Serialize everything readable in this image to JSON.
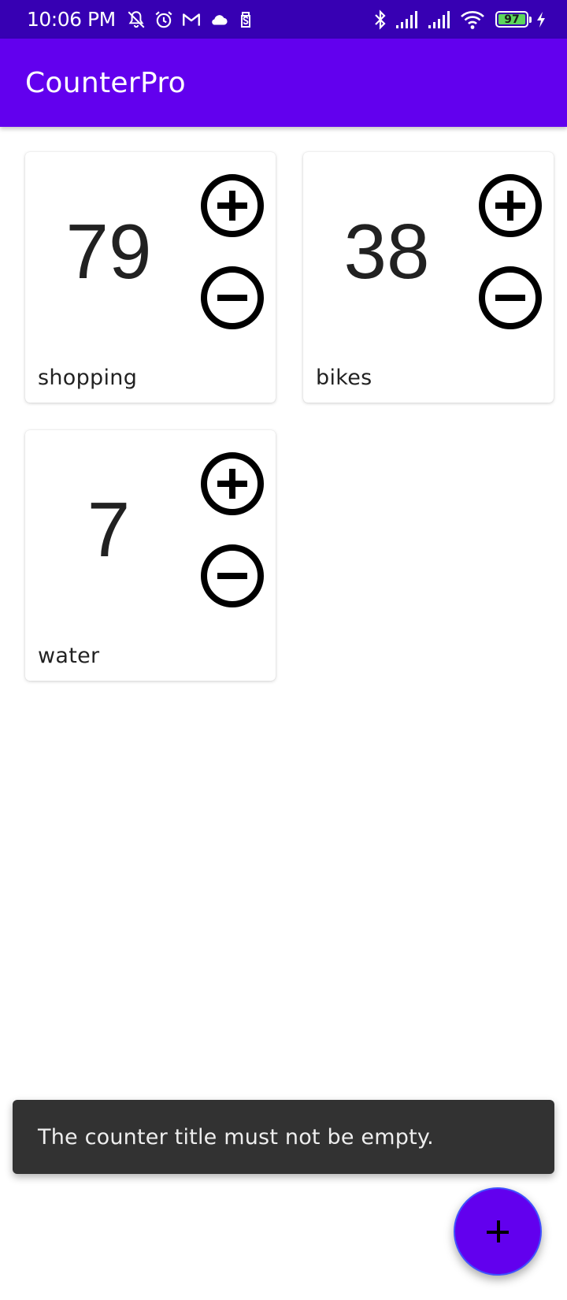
{
  "status_bar": {
    "time": "10:06 PM",
    "left_icons": [
      "notifications-off-icon",
      "alarm-icon",
      "gmail-icon",
      "cloud-icon",
      "sim-toolkit-icon"
    ],
    "right_icons": [
      "bluetooth-icon",
      "signal-icon",
      "signal-icon",
      "wifi-icon"
    ],
    "battery_percent": "97",
    "charging": true,
    "color": "#3700b3"
  },
  "app_bar": {
    "title": "CounterPro",
    "color": "#6200ee"
  },
  "counters": [
    {
      "title": "shopping",
      "value": "79"
    },
    {
      "title": "bikes",
      "value": "38"
    },
    {
      "title": "water",
      "value": "7"
    }
  ],
  "snackbar": {
    "message": "The counter title must not be empty."
  },
  "fab": {
    "icon": "add-icon",
    "color": "#6200ee"
  }
}
